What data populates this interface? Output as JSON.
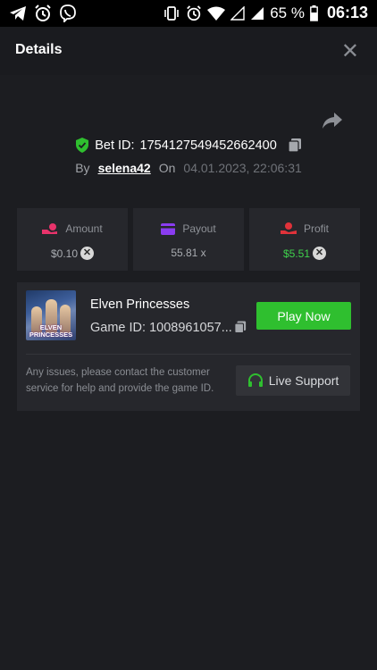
{
  "status_bar": {
    "battery": "65 %",
    "time": "06:13"
  },
  "header": {
    "title": "Details",
    "close": "✕"
  },
  "bet": {
    "id_label": "Bet ID:",
    "id_value": "1754127549452662400",
    "by_label": "By",
    "user": "selena42",
    "on_label": "On",
    "date": "04.01.2023, 22:06:31"
  },
  "stats": {
    "amount": {
      "label": "Amount",
      "value": "$0.10"
    },
    "payout": {
      "label": "Payout",
      "value": "55.81 x"
    },
    "profit": {
      "label": "Profit",
      "value": "$5.51"
    }
  },
  "game": {
    "thumb_caption": "ELVEN PRINCESSES",
    "name": "Elven Princesses",
    "id_text": "Game ID: 1008961057...",
    "play_label": "Play Now",
    "help_text": "Any issues, please contact the customer service for help and provide the game ID.",
    "support_label": "Live Support"
  },
  "colors": {
    "accent_green": "#2fbf2f",
    "profit_green": "#3fd14c",
    "amount_pink": "#e8336b",
    "payout_purple": "#8a3cf0",
    "profit_red": "#e0323a"
  }
}
